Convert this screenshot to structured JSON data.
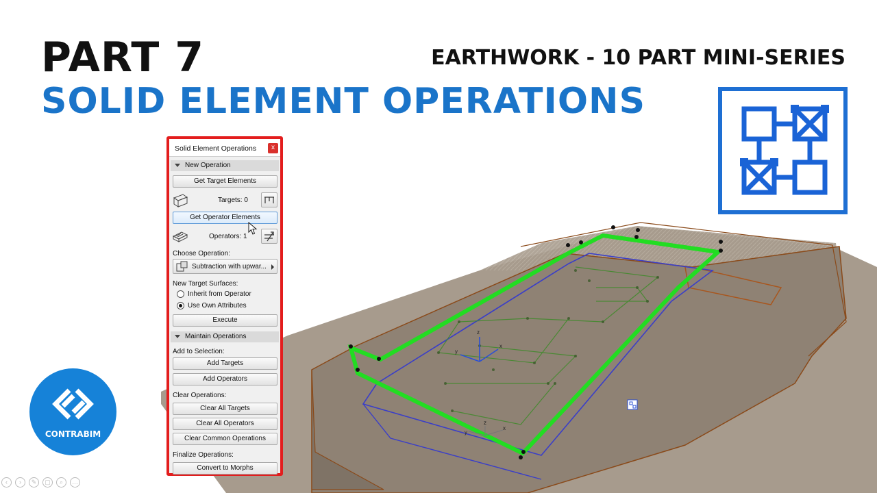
{
  "headline": {
    "part": "PART 7",
    "subtitle": "SOLID ELEMENT OPERATIONS",
    "series": "EARTHWORK - 10 PART MINI-SERIES"
  },
  "logo": {
    "text": "CONTRABIM"
  },
  "palette": {
    "title": "Solid Element Operations",
    "close_label": "x",
    "new_operation": {
      "header": "New Operation",
      "get_targets_button": "Get Target Elements",
      "targets_label": "Targets: 0",
      "get_operators_button": "Get Operator Elements",
      "operators_label": "Operators: 1",
      "choose_operation_label": "Choose Operation:",
      "operation_value": "Subtraction with upwar...",
      "new_target_surfaces_label": "New Target Surfaces:",
      "radio_inherit": "Inherit from Operator",
      "radio_own": "Use Own Attributes",
      "selected_surface_option": "Use Own Attributes",
      "execute_button": "Execute"
    },
    "maintain_operations": {
      "header": "Maintain Operations",
      "add_to_selection_label": "Add to Selection:",
      "add_targets_button": "Add Targets",
      "add_operators_button": "Add Operators",
      "clear_operations_label": "Clear Operations:",
      "clear_targets_button": "Clear All Targets",
      "clear_operators_button": "Clear All Operators",
      "clear_common_button": "Clear Common Operations",
      "finalize_label": "Finalize Operations:",
      "convert_button": "Convert to Morphs"
    }
  },
  "viewport": {
    "axis_labels": [
      "x",
      "y",
      "z",
      "x",
      "y",
      "z"
    ]
  },
  "icons": {
    "tool_icon": "solid-element-operations-icon",
    "logo_icon": "contrabim-logo-icon",
    "targets_icon": "target-element-icon",
    "operators_icon": "operator-element-icon",
    "cursor": "mouse-pointer-icon"
  },
  "colors": {
    "accent_blue": "#1a74c9",
    "palette_border": "#e31d1d",
    "selection_green": "#22dd22",
    "terrain": "#9d9082"
  }
}
